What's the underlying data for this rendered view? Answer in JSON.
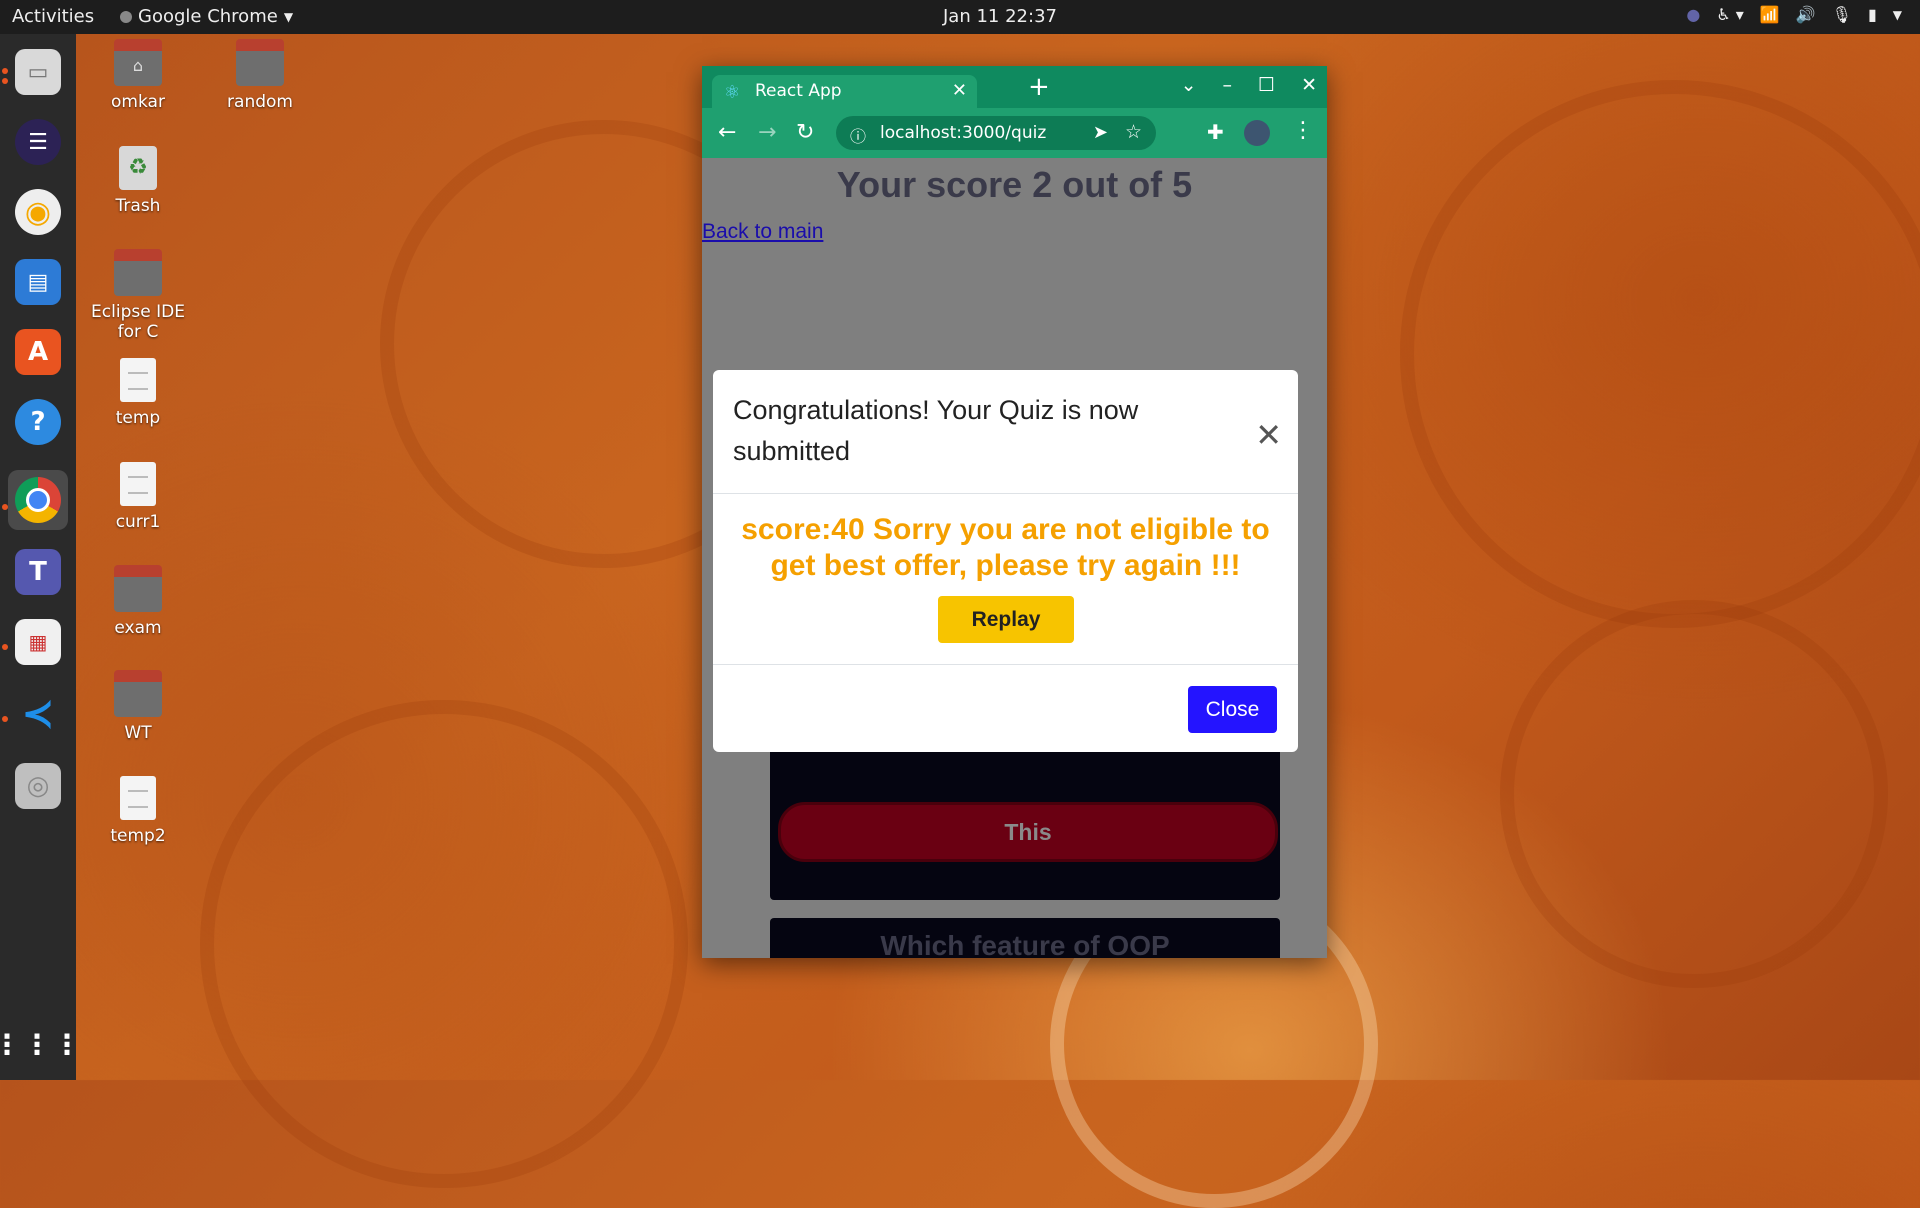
{
  "topbar": {
    "activities": "Activities",
    "app_name": "Google Chrome",
    "clock": "Jan 11  22:37"
  },
  "desktop": {
    "icons": [
      {
        "label": "omkar"
      },
      {
        "label": "random"
      },
      {
        "label": "Trash"
      },
      {
        "label": "Eclipse IDE for C"
      },
      {
        "label": "temp"
      },
      {
        "label": "curr1"
      },
      {
        "label": "exam"
      },
      {
        "label": "WT"
      },
      {
        "label": "temp2"
      }
    ]
  },
  "browser": {
    "tab_title": "React App",
    "url": "localhost:3000/quiz"
  },
  "page": {
    "score_heading": "Your score 2 out of 5",
    "back_link": "Back to main",
    "option_this": "This",
    "next_question": "Which feature of OOP"
  },
  "modal": {
    "title": "Congratulations! Your Quiz is now submitted",
    "body_text": "score:40 Sorry you are not eligible to get best offer, please try again !!!",
    "replay_label": "Replay",
    "close_label": "Close"
  },
  "colors": {
    "score_text": "#f5a000",
    "replay_button": "#f7c400",
    "close_button": "#2414ff",
    "browser_theme": "#1fa070"
  }
}
